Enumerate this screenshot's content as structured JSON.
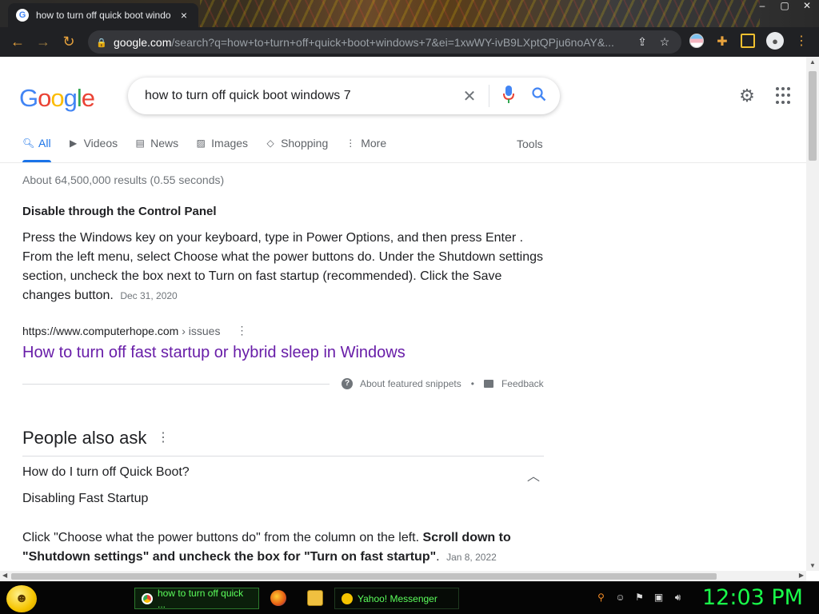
{
  "browser": {
    "tab_title": "how to turn off quick boot windo",
    "tab_close": "×",
    "url_host": "google.com",
    "url_rest": "/search?q=how+to+turn+off+quick+boot+windows+7&ei=1xwWY-ivB9LXptQPju6noAY&...",
    "window_controls": [
      "–",
      "▢",
      "✕"
    ]
  },
  "search": {
    "query": "how to turn off quick boot windows 7"
  },
  "tabs": [
    {
      "label": "All"
    },
    {
      "label": "Videos"
    },
    {
      "label": "News"
    },
    {
      "label": "Images"
    },
    {
      "label": "Shopping"
    },
    {
      "label": "More"
    }
  ],
  "tools_label": "Tools",
  "result_stats": "About 64,500,000 results (0.55 seconds)",
  "featured_snippet": {
    "title": "Disable through the Control Panel",
    "body": "Press the Windows key on your keyboard, type in Power Options, and then press Enter . From the left menu, select Choose what the power buttons do. Under the Shutdown settings section, uncheck the box next to Turn on fast startup (recommended). Click the Save changes button.",
    "date": "Dec 31, 2020",
    "cite_url": "https://www.computerhope.com",
    "cite_crumb": "› issues",
    "link_title": "How to turn off fast startup or hybrid sleep in Windows",
    "about_label": "About featured snippets",
    "feedback_label": "Feedback",
    "separator": "•"
  },
  "people_also_ask": {
    "title": "People also ask",
    "question": "How do I turn off Quick Boot?",
    "answer_heading": "Disabling Fast Startup",
    "answer_plain": "Click \"Choose what the power buttons do\" from the column on the left. ",
    "answer_bold": "Scroll down to \"Shutdown settings\" and uncheck the box for \"Turn on fast startup\"",
    "answer_end": ".",
    "answer_date": "Jan 8, 2022"
  },
  "taskbar": {
    "chrome_task": "how to turn off quick ...",
    "yahoo_task": "Yahoo! Messenger",
    "clock": "12:03 PM"
  },
  "colors": {
    "link_visited": "#681da8",
    "accent": "#1a73e8",
    "clock_green": "#19ff4a"
  }
}
